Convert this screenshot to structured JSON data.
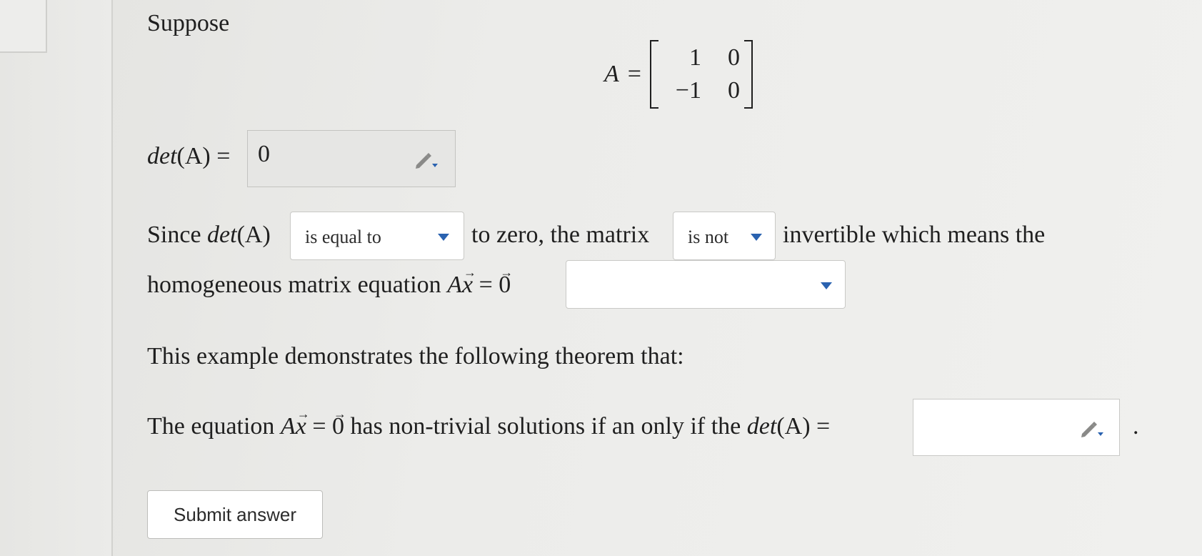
{
  "intro_label": "Suppose",
  "matrix": {
    "lhs": "A",
    "eq": "=",
    "rows": [
      [
        "1",
        "0"
      ],
      [
        "−1",
        "0"
      ]
    ]
  },
  "det_line": {
    "label_fn": "det",
    "label_arg": "(A)",
    "eq": "=",
    "answer_value": "0"
  },
  "sentence1": {
    "since": "Since",
    "det_fn": "det",
    "det_arg": "(A)",
    "after_first_dropdown": "to zero, the matrix",
    "after_second_dropdown": "invertible which means the",
    "line2_prefix": "homogeneous matrix equation",
    "dropdown1_value": "is equal to",
    "dropdown2_value": "is not",
    "dropdown3_value": ""
  },
  "theorem_intro": "This example demonstrates the following theorem that:",
  "theorem": {
    "prefix": "The equation",
    "middle": "has non-trivial solutions if an only if the",
    "det_fn": "det",
    "det_arg": "(A)",
    "eq": "=",
    "suffix": ".",
    "answer_value": ""
  },
  "equation": {
    "A": "A",
    "x": "x",
    "eq": "=",
    "zero": "0",
    "arrow": "→"
  },
  "submit_label": "Submit answer",
  "colors": {
    "caret": "#2a62b0",
    "input_filled_bg": "#e6e6e4",
    "border": "#c9c9c6"
  }
}
